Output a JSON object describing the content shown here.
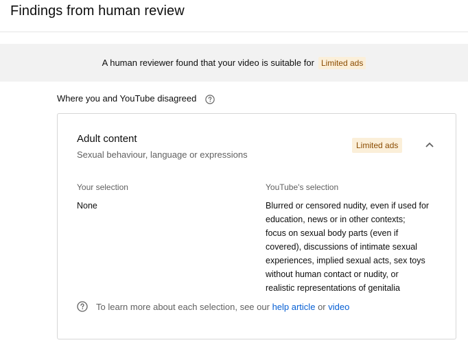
{
  "page": {
    "title": "Findings from human review"
  },
  "banner": {
    "text": "A human reviewer found that your video is suitable for",
    "badge": "Limited ads",
    "badge_bg": "#fbefd9",
    "badge_fg": "#8a4b00"
  },
  "disagreement": {
    "heading": "Where you and YouTube disagreed",
    "help_icon": "help-circle-icon"
  },
  "card": {
    "category_title": "Adult content",
    "category_subtitle": "Sexual behaviour, language or expressions",
    "badge": "Limited ads",
    "collapse_icon": "chevron-up-icon",
    "your_selection_label": "Your selection",
    "your_selection_value": "None",
    "youtube_selection_label": "YouTube's selection",
    "youtube_selection_lines": [
      "Blurred or censored nudity, even if used for",
      "education, news or in other contexts;",
      "focus on sexual body parts (even if",
      "covered), discussions of intimate sexual",
      "experiences, implied sexual acts, sex toys",
      "without human contact or nudity, or",
      "realistic representations of genitalia"
    ],
    "learn_more": {
      "prefix": "To learn more about each selection, see our",
      "help_link": "help article",
      "or": "or",
      "video_link": "video",
      "link_color": "#065fd4"
    }
  }
}
